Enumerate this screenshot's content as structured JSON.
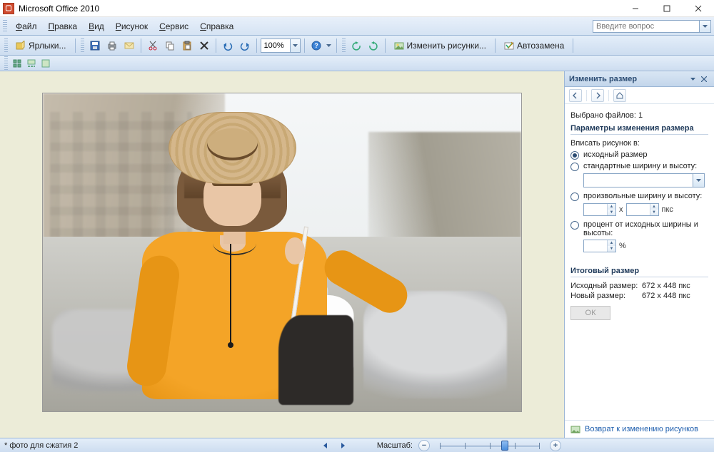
{
  "window": {
    "title": "Microsoft Office 2010",
    "question_placeholder": "Введите вопрос"
  },
  "menu": {
    "items": [
      "Файл",
      "Правка",
      "Вид",
      "Рисунок",
      "Сервис",
      "Справка"
    ]
  },
  "toolbar": {
    "shortcuts_label": "Ярлыки...",
    "zoom_value": "100%",
    "edit_pictures_label": "Изменить рисунки...",
    "autoreplace_label": "Автозамена"
  },
  "sidepanel": {
    "title": "Изменить размер",
    "selected_files_label": "Выбрано файлов:",
    "selected_files_count": "1",
    "section_params": "Параметры изменения размера",
    "fit_in_label": "Вписать рисунок в:",
    "radio_original": "исходный размер",
    "radio_standard": "стандартные ширину и высоту:",
    "radio_custom": "произвольные ширину и высоту:",
    "radio_percent": "процент от исходных ширины и высоты:",
    "unit_x": "x",
    "unit_px": "пкс",
    "unit_pct": "%",
    "section_result": "Итоговый размер",
    "orig_size_label": "Исходный размер:",
    "orig_size_value": "672 x 448 пкс",
    "new_size_label": "Новый размер:",
    "new_size_value": "672 x 448 пкс",
    "ok_label": "ОК",
    "footer_link": "Возврат к изменению рисунков"
  },
  "status": {
    "filename": "* фото для сжатия 2",
    "zoom_label": "Масштаб:"
  }
}
